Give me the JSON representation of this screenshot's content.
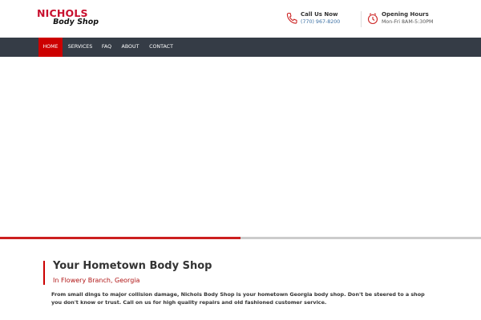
{
  "logo": {
    "line1": "NICHOLS",
    "line2": "Body Shop"
  },
  "header": {
    "phone": {
      "label": "Call Us Now",
      "value": "(770) 967-8200",
      "icon": "phone-icon"
    },
    "hours": {
      "label": "Opening Hours",
      "value": "Mon-Fri 8AM-5:30PM",
      "icon": "clock-icon"
    }
  },
  "nav": {
    "items": [
      {
        "label": "HOME",
        "active": true
      },
      {
        "label": "SERVICES",
        "active": false
      },
      {
        "label": "FAQ",
        "active": false
      },
      {
        "label": "ABOUT",
        "active": false
      },
      {
        "label": "CONTACT",
        "active": false
      }
    ]
  },
  "slider": {
    "progress": 0.5
  },
  "intro": {
    "title": "Your Hometown Body Shop",
    "subtitle": "In Flowery Branch, Georgia",
    "body": "From small dings to major collision damage, Nichols Body Shop is your hometown Georgia body shop. Don't be steered to a shop you don't know or trust. Call on us for high quality repairs and old fashioned customer service."
  },
  "colors": {
    "brand_red": "#cc0000",
    "nav_bg": "#353c46",
    "link_blue": "#3a6fa3"
  }
}
